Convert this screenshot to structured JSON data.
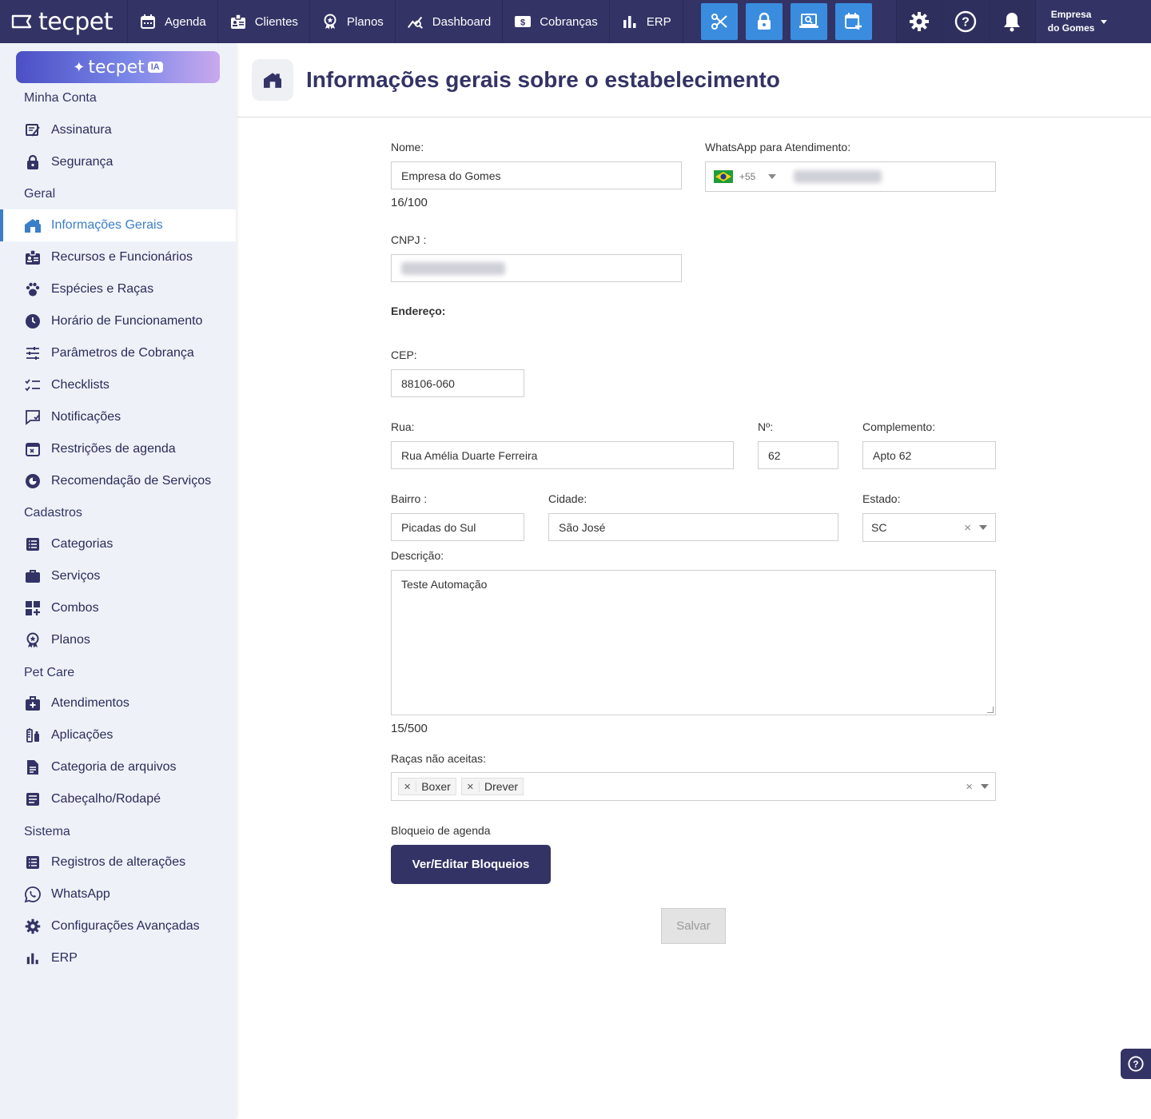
{
  "topbar": {
    "logo_text": "tecpet",
    "nav": [
      {
        "label": "Agenda",
        "icon": "calendar-icon"
      },
      {
        "label": "Clientes",
        "icon": "badge-icon"
      },
      {
        "label": "Planos",
        "icon": "award-icon"
      },
      {
        "label": "Dashboard",
        "icon": "chart-line-icon"
      },
      {
        "label": "Cobranças",
        "icon": "money-icon"
      },
      {
        "label": "ERP",
        "icon": "bar-chart-icon"
      }
    ],
    "quick_actions": [
      "scissors-icon",
      "lock-icon",
      "laptop-search-icon",
      "calendar-plus-icon"
    ],
    "quick_color": "#3a8dde",
    "company_line1": "Empresa",
    "company_line2": "do Gomes"
  },
  "sidebar": {
    "ia_label": "tecpet",
    "ia_badge": "IA",
    "sections": {
      "account": "Minha Conta",
      "general": "Geral",
      "registers": "Cadastros",
      "petcare": "Pet Care",
      "system": "Sistema"
    },
    "items": [
      {
        "label": "Assinatura"
      },
      {
        "label": "Segurança"
      },
      {
        "label": "Informações Gerais"
      },
      {
        "label": "Recursos e Funcionários"
      },
      {
        "label": "Espécies e Raças"
      },
      {
        "label": "Horário de Funcionamento"
      },
      {
        "label": "Parâmetros de Cobrança"
      },
      {
        "label": "Checklists"
      },
      {
        "label": "Notificações"
      },
      {
        "label": "Restrições de agenda"
      },
      {
        "label": "Recomendação de Serviços"
      },
      {
        "label": "Categorias"
      },
      {
        "label": "Serviços"
      },
      {
        "label": "Combos"
      },
      {
        "label": "Planos"
      },
      {
        "label": "Atendimentos"
      },
      {
        "label": "Aplicações"
      },
      {
        "label": "Categoria de arquivos"
      },
      {
        "label": "Cabeçalho/Rodapé"
      },
      {
        "label": "Registros de alterações"
      },
      {
        "label": "WhatsApp"
      },
      {
        "label": "Configurações Avançadas"
      },
      {
        "label": "ERP"
      }
    ]
  },
  "page": {
    "title": "Informações gerais sobre o estabelecimento"
  },
  "form": {
    "name_label": "Nome:",
    "name_value": "Empresa do Gomes",
    "name_counter": "16/100",
    "whatsapp_label": "WhatsApp para Atendimento:",
    "whatsapp_code": "+55",
    "cnpj_label": "CNPJ :",
    "address_label": "Endereço:",
    "cep_label": "CEP:",
    "cep_value": "88106-060",
    "street_label": "Rua:",
    "street_value": "Rua Amélia Duarte Ferreira",
    "number_label": "Nº:",
    "number_value": "62",
    "complement_label": "Complemento:",
    "complement_value": "Apto 62",
    "district_label": "Bairro :",
    "district_value": "Picadas do Sul",
    "city_label": "Cidade:",
    "city_value": "São José",
    "state_label": "Estado:",
    "state_value": "SC",
    "description_label": "Descrição:",
    "description_value": "Teste Automação",
    "description_counter": "15/500",
    "breeds_label": "Raças não aceitas:",
    "breeds": [
      "Boxer",
      "Drever"
    ],
    "block_label": "Bloqueio de agenda",
    "block_button": "Ver/Editar Bloqueios",
    "save_button": "Salvar"
  }
}
